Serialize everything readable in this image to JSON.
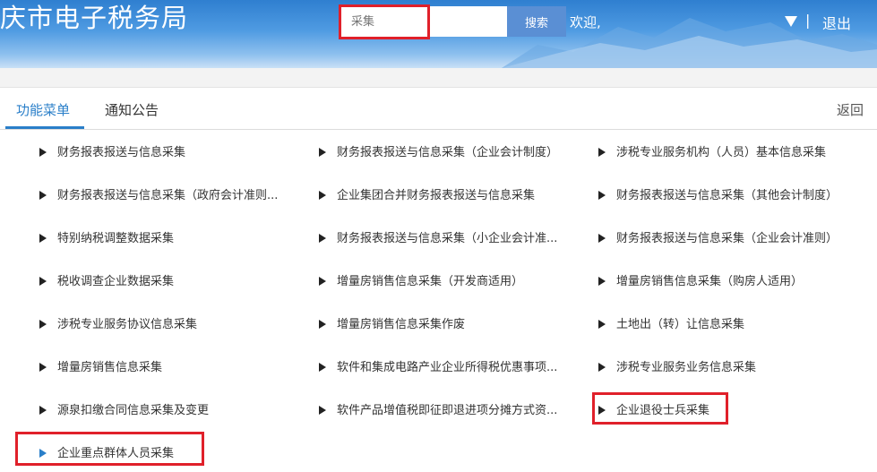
{
  "header": {
    "site_title": "庆市电子税务局",
    "search": {
      "placeholder": "采集",
      "button_label": "搜索"
    },
    "welcome_text": "欢迎,",
    "separator": "|",
    "logout_label": "退出"
  },
  "tabs": [
    {
      "label": "功能菜单",
      "active": true
    },
    {
      "label": "通知公告",
      "active": false
    }
  ],
  "back_label": "返回",
  "menu": {
    "col1": [
      "财务报表报送与信息采集",
      "财务报表报送与信息采集（政府会计准则...",
      "特别纳税调整数据采集",
      "税收调查企业数据采集",
      "涉税专业服务协议信息采集",
      "增量房销售信息采集",
      "源泉扣缴合同信息采集及变更",
      "企业重点群体人员采集"
    ],
    "col2": [
      "财务报表报送与信息采集（企业会计制度）",
      "企业集团合并财务报表报送与信息采集",
      "财务报表报送与信息采集（小企业会计准...",
      "增量房销售信息采集（开发商适用）",
      "增量房销售信息采集作废",
      "软件和集成电路产业企业所得税优惠事项...",
      "软件产品增值税即征即退进项分摊方式资..."
    ],
    "col3": [
      "涉税专业服务机构（人员）基本信息采集",
      "财务报表报送与信息采集（其他会计制度）",
      "财务报表报送与信息采集（企业会计准则）",
      "增量房销售信息采集（购房人适用）",
      "土地出（转）让信息采集",
      "涉税专业服务业务信息采集",
      "企业退役士兵采集"
    ]
  },
  "colors": {
    "accent": "#2a7fc9",
    "highlight": "#e0202a"
  }
}
